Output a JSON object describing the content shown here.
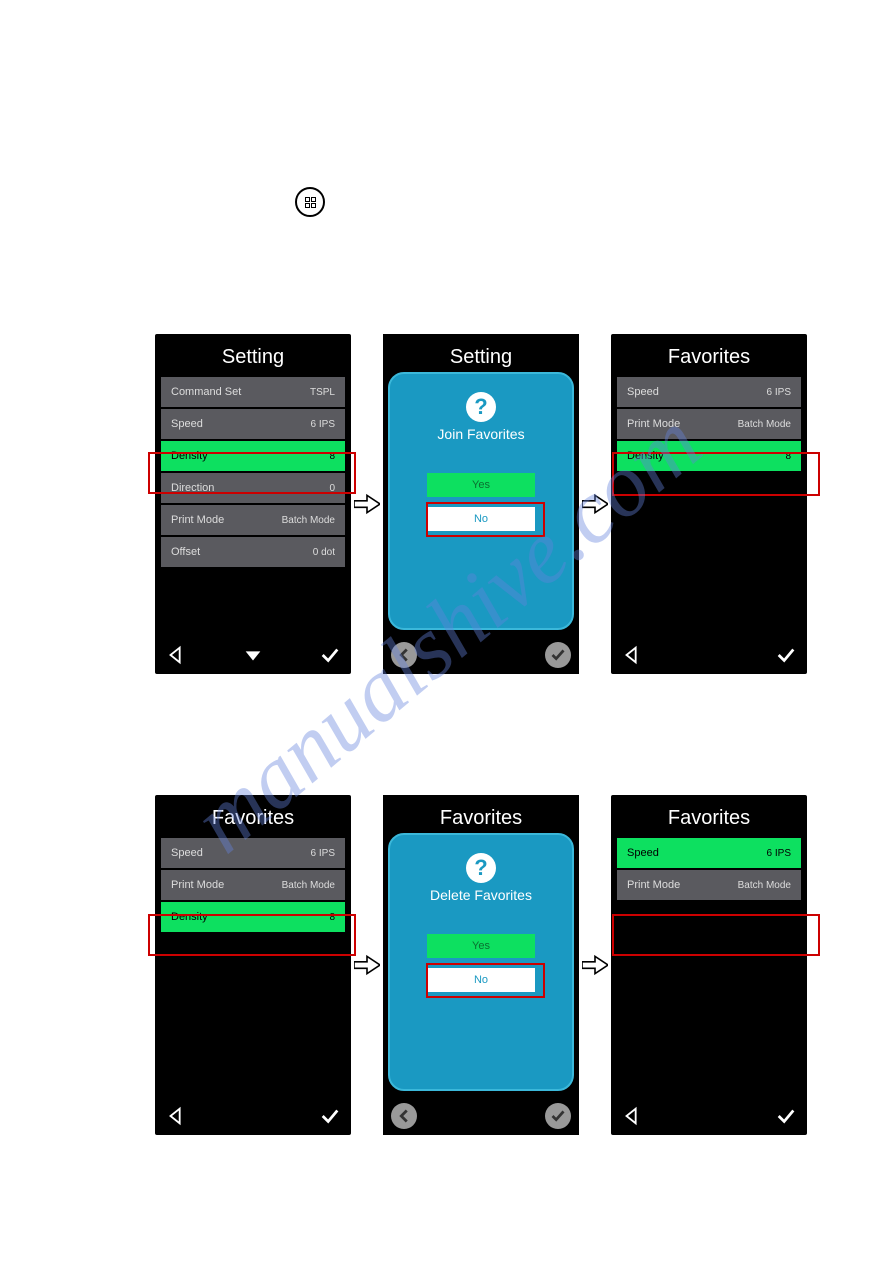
{
  "menu_icon_name": "menu-icon",
  "watermark": "manualshive.com",
  "row1": {
    "screen_a": {
      "title": "Setting",
      "items": [
        {
          "label": "Command Set",
          "value": "TSPL",
          "highlighted": false
        },
        {
          "label": "Speed",
          "value": "6 IPS",
          "highlighted": false
        },
        {
          "label": "Density",
          "value": "8",
          "highlighted": true
        },
        {
          "label": "Direction",
          "value": "0",
          "highlighted": false
        },
        {
          "label": "Print Mode",
          "value": "Batch Mode",
          "highlighted": false
        },
        {
          "label": "Offset",
          "value": "0 dot",
          "highlighted": false
        }
      ],
      "nav": [
        "back-triangle",
        "down-triangle",
        "check"
      ]
    },
    "dialog": {
      "title": "Setting",
      "prompt": "Join Favorites",
      "yes": "Yes",
      "no": "No"
    },
    "screen_c": {
      "title": "Favorites",
      "items": [
        {
          "label": "Speed",
          "value": "6 IPS",
          "highlighted": false
        },
        {
          "label": "Print Mode",
          "value": "Batch Mode",
          "highlighted": false
        },
        {
          "label": "Density",
          "value": "8",
          "highlighted": true
        }
      ],
      "nav": [
        "back-triangle",
        "",
        "check"
      ]
    }
  },
  "row2": {
    "screen_a": {
      "title": "Favorites",
      "items": [
        {
          "label": "Speed",
          "value": "6 IPS",
          "highlighted": false
        },
        {
          "label": "Print Mode",
          "value": "Batch Mode",
          "highlighted": false
        },
        {
          "label": "Density",
          "value": "8",
          "highlighted": true
        }
      ],
      "nav": [
        "back-triangle",
        "",
        "check"
      ]
    },
    "dialog": {
      "title": "Favorites",
      "prompt": "Delete Favorites",
      "yes": "Yes",
      "no": "No"
    },
    "screen_c": {
      "title": "Favorites",
      "items": [
        {
          "label": "Speed",
          "value": "6 IPS",
          "highlighted": true
        },
        {
          "label": "Print Mode",
          "value": "Batch Mode",
          "highlighted": false
        }
      ],
      "nav": [
        "back-triangle",
        "",
        "check"
      ]
    }
  }
}
